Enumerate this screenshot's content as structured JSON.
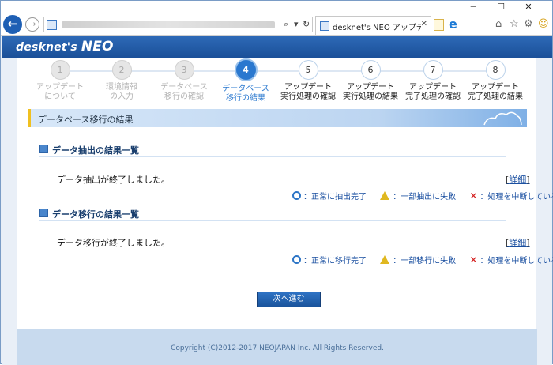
{
  "window": {
    "minimize": "─",
    "maximize": "☐",
    "close": "✕"
  },
  "browser": {
    "back": "←",
    "forward": "→",
    "addr_search": "⌕",
    "addr_dropdown": "▾",
    "addr_refresh": "↻",
    "tab_title": "desknet's NEO アップデートツ...",
    "tab_close": "✕",
    "toolbar_icons": [
      "⌂",
      "☆",
      "⚙",
      "☺"
    ]
  },
  "app": {
    "logo_pre": "desknet's ",
    "logo_neo": "NEO"
  },
  "steps": [
    {
      "n": "1",
      "label1": "アップデート",
      "label2": "について",
      "state": "done"
    },
    {
      "n": "2",
      "label1": "環境情報",
      "label2": "の入力",
      "state": "done"
    },
    {
      "n": "3",
      "label1": "データベース",
      "label2": "移行の確認",
      "state": "done"
    },
    {
      "n": "4",
      "label1": "データベース",
      "label2": "移行の結果",
      "state": "current"
    },
    {
      "n": "5",
      "label1": "アップデート",
      "label2": "実行処理の確認",
      "state": "todo"
    },
    {
      "n": "6",
      "label1": "アップデート",
      "label2": "実行処理の結果",
      "state": "todo"
    },
    {
      "n": "7",
      "label1": "アップデート",
      "label2": "完了処理の確認",
      "state": "todo"
    },
    {
      "n": "8",
      "label1": "アップデート",
      "label2": "完了処理の結果",
      "state": "todo"
    }
  ],
  "section_title": "データベース移行の結果",
  "extract": {
    "title": "データ抽出の結果一覧",
    "message": "データ抽出が終了しました。",
    "detail_link": "詳細",
    "legend_ok": "：正常に抽出完了",
    "legend_warn": "：一部抽出に失敗",
    "legend_err": "：処理を中断している"
  },
  "migrate": {
    "title": "データ移行の結果一覧",
    "message": "データ移行が終了しました。",
    "detail_link": "詳細",
    "legend_ok": "：正常に移行完了",
    "legend_warn": "：一部移行に失敗",
    "legend_err": "：処理を中断している"
  },
  "next_button": "次へ進む",
  "footer": "Copyright (C)2012-2017 NEOJAPAN Inc. All Rights Reserved.",
  "colors": {
    "accent": "#2a78cf",
    "header": "#1a4f97",
    "error": "#d42020",
    "warn": "#e0b820"
  }
}
